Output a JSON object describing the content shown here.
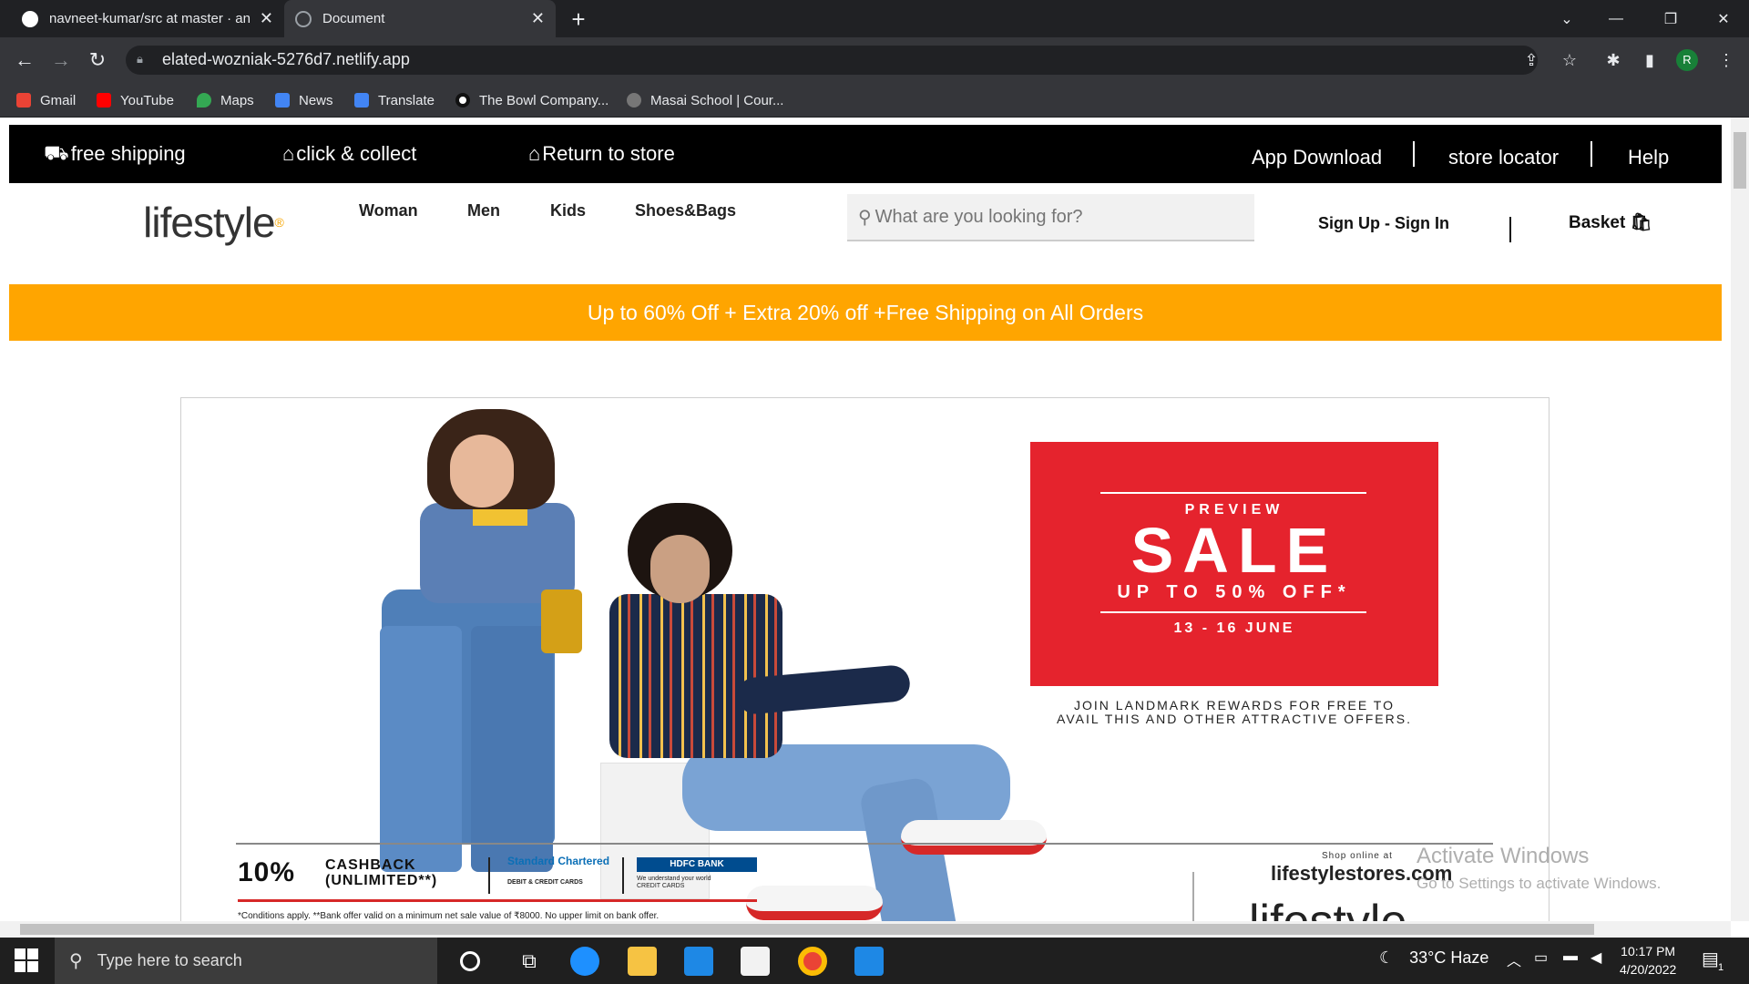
{
  "browser": {
    "tabs": [
      {
        "title": "navneet-kumar/src at master · an"
      },
      {
        "title": "Document"
      }
    ],
    "url": "elated-wozniak-5276d7.netlify.app",
    "profile_initial": "R",
    "bookmarks": [
      {
        "label": "Gmail",
        "icon": "gmail-icon",
        "color": "#ea4335"
      },
      {
        "label": "YouTube",
        "icon": "youtube-icon",
        "color": "#ff0000"
      },
      {
        "label": "Maps",
        "icon": "maps-icon",
        "color": "#34a853"
      },
      {
        "label": "News",
        "icon": "news-icon",
        "color": "#4285f4"
      },
      {
        "label": "Translate",
        "icon": "translate-icon",
        "color": "#4285f4"
      },
      {
        "label": "The Bowl Company...",
        "icon": "bowl-company-icon",
        "color": "#111111"
      },
      {
        "label": "Masai School | Cour...",
        "icon": "masai-icon",
        "color": "#777777"
      }
    ]
  },
  "site": {
    "top_strip": {
      "free_shipping": "free shipping",
      "click_collect": "click & collect",
      "return_store": "Return to store",
      "app_download": "App Download",
      "store_locator": "store locator",
      "help": "Help"
    },
    "logo": "lifestyle",
    "nav": [
      "Woman",
      "Men",
      "Kids",
      "Shoes&Bags"
    ],
    "search_placeholder": "What are you looking for?",
    "sign_in": "Sign Up - Sign In",
    "basket": "Basket",
    "promo": "Up to 60% Off + Extra 20% off +Free Shipping on All Orders",
    "banner": {
      "preview": "PREVIEW",
      "sale": "SALE",
      "upto": "UP TO 50% OFF*",
      "dates": "13 - 16 JUNE",
      "rewards_line1": "JOIN LANDMARK REWARDS FOR FREE TO",
      "rewards_line2": "AVAIL THIS AND OTHER ATTRACTIVE OFFERS.",
      "cashback_pct": "10%",
      "cashback_word": "CASHBACK",
      "cashback_unlimited": "(UNLIMITED**)",
      "standard_chartered": "Standard Chartered",
      "sc_sub": "DEBIT & CREDIT CARDS",
      "hdfc": "HDFC BANK",
      "hdfc_sub1": "We understand your world",
      "hdfc_sub2": "CREDIT CARDS",
      "terms": "*Conditions apply. **Bank offer valid on a minimum net sale value of ₹8000. No upper limit on bank offer.",
      "shop_online": "Shop online at",
      "site_url": "lifestylestores.com",
      "big_logo": "lifestyle"
    },
    "colors": {
      "promo": "#ffa500",
      "sale": "#e5232d",
      "strip": "#000000"
    }
  },
  "watermark": {
    "line1": "Activate Windows",
    "line2": "Go to Settings to activate Windows."
  },
  "taskbar": {
    "search_placeholder": "Type here to search",
    "weather": "33°C  Haze",
    "time": "10:17 PM",
    "date": "4/20/2022",
    "notifications": "1"
  }
}
